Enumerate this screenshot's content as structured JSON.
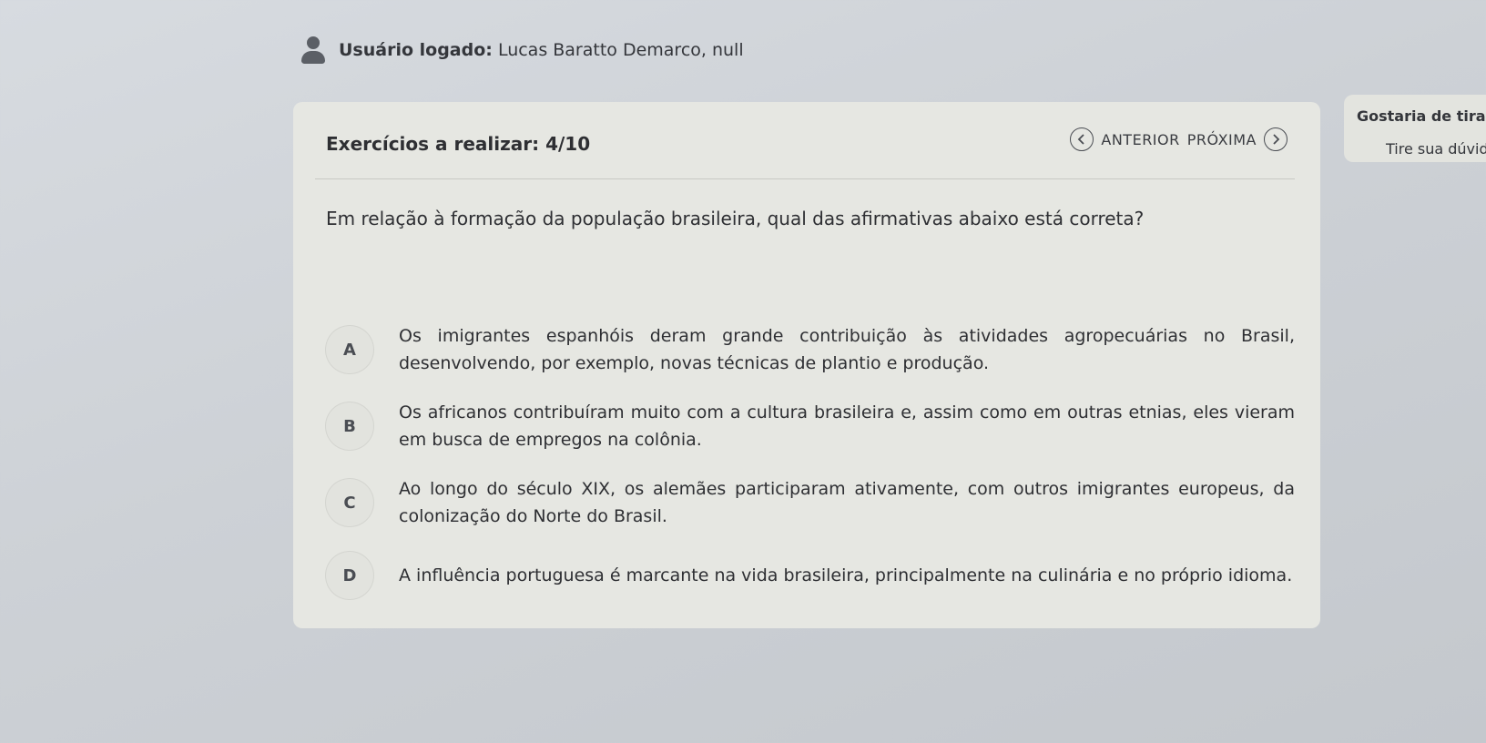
{
  "user": {
    "label": "Usuário logado:",
    "name": "Lucas Baratto Demarco, null",
    "icon": "user-icon"
  },
  "exercise": {
    "progress_label": "Exercícios a realizar: 4/10",
    "current": 4,
    "total": 10
  },
  "navigation": {
    "previous_label": "ANTERIOR",
    "next_label": "PRÓXIMA",
    "previous_icon": "chevron-left-icon",
    "next_icon": "chevron-right-icon"
  },
  "question": {
    "text": "Em relação à formação da população brasileira, qual das afirmativas abaixo está correta?"
  },
  "options": [
    {
      "letter": "A",
      "text": "Os imigrantes espanhóis deram grande contribuição às atividades agropecuárias no Brasil, desenvolvendo, por exemplo, novas técnicas de plantio e produção."
    },
    {
      "letter": "B",
      "text": "Os africanos contribuíram muito com a cultura brasileira e, assim como em outras etnias, eles vieram em busca de empregos na colônia."
    },
    {
      "letter": "C",
      "text": "Ao longo do século XIX, os alemães participaram ativamente, com outros imigrantes europeus, da colonização do Norte do Brasil."
    },
    {
      "letter": "D",
      "text": "A influência portuguesa é marcante na vida brasileira, principalmente na culinária e no próprio idioma."
    }
  ],
  "side_panel": {
    "title": "Gostaria de tirar u",
    "subtitle": "Tire sua dúvid"
  },
  "colors": {
    "background": "#cdd1d6",
    "card": "#e6e7e2",
    "text": "#2e2f33",
    "icon": "#5b5f66"
  }
}
